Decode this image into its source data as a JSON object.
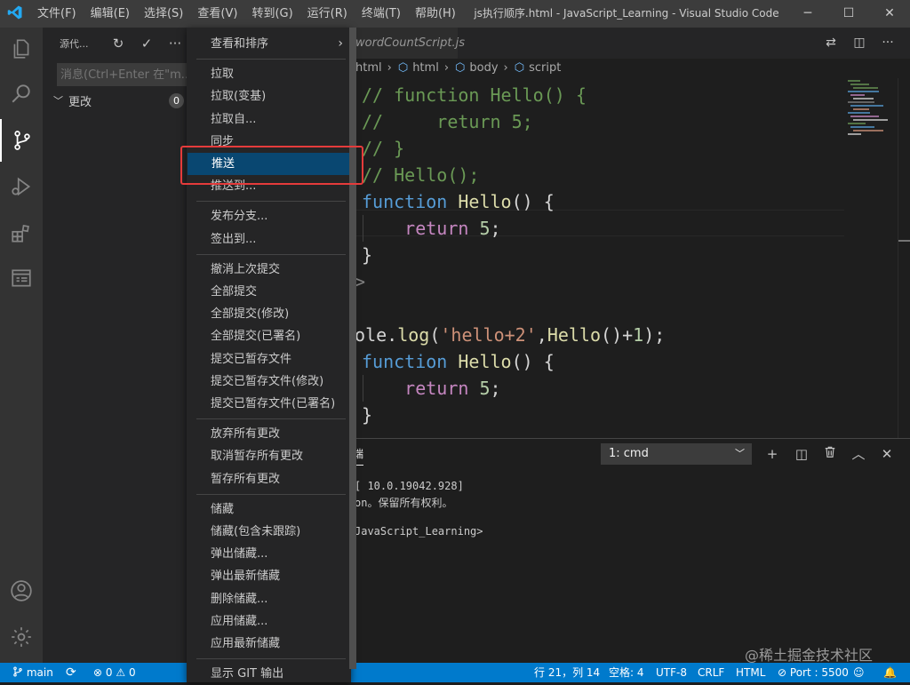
{
  "titlebar": {
    "app_icon": "vscode-logo",
    "menus": [
      "文件(F)",
      "编辑(E)",
      "选择(S)",
      "查看(V)",
      "转到(G)",
      "运行(R)",
      "终端(T)",
      "帮助(H)"
    ],
    "title": "js执行顺序.html - JavaScript_Learning - Visual Studio Code",
    "minimize": "─",
    "maximize": "☐",
    "close": "✕"
  },
  "activitybar": {
    "icons": [
      "explorer-icon",
      "search-icon",
      "source-control-icon",
      "run-debug-icon",
      "extensions-icon",
      "remote-explorer-icon",
      "account-icon",
      "manage-gear-icon"
    ]
  },
  "sidebar": {
    "title": "源代...",
    "refresh": "↻",
    "commit": "✓",
    "more": "···",
    "commit_placeholder": "消息(Ctrl+Enter 在\"m...",
    "changes_label": "更改",
    "changes_count": "0"
  },
  "editor": {
    "tab_label": "wordCountScript.js",
    "breadcrumb": [
      "html",
      "html",
      "body",
      "script"
    ],
    "code_lines": [
      {
        "parts": [
          [
            "cmt",
            "// function Hello() {"
          ]
        ]
      },
      {
        "parts": [
          [
            "cmt",
            "//     return 5;"
          ]
        ]
      },
      {
        "parts": [
          [
            "cmt",
            "// }"
          ]
        ]
      },
      {
        "parts": [
          [
            "cmt",
            "// Hello();"
          ]
        ]
      },
      {
        "parts": [
          [
            "kw",
            "function"
          ],
          [
            "pl",
            " "
          ],
          [
            "fn",
            "Hello"
          ],
          [
            "pl",
            "() {"
          ]
        ]
      },
      {
        "parts": [
          [
            "pl",
            "    "
          ],
          [
            "ctl",
            "return"
          ],
          [
            "pl",
            " "
          ],
          [
            "num",
            "5"
          ],
          [
            "pl",
            ";"
          ]
        ]
      },
      {
        "parts": [
          [
            "pl",
            "}"
          ]
        ]
      },
      {
        "parts": [
          [
            "tag",
            "t>"
          ]
        ]
      },
      {
        "parts": [
          [
            "tag",
            ">"
          ]
        ]
      },
      {
        "parts": [
          [
            "pl",
            "sole."
          ],
          [
            "fn",
            "log"
          ],
          [
            "pl",
            "("
          ],
          [
            "str",
            "'hello+2'"
          ],
          [
            "pl",
            ","
          ],
          [
            "fn",
            "Hello"
          ],
          [
            "pl",
            "()+"
          ],
          [
            "num",
            "1"
          ],
          [
            "pl",
            ");"
          ]
        ]
      },
      {
        "parts": [
          [
            "kw",
            "function"
          ],
          [
            "pl",
            " "
          ],
          [
            "fn",
            "Hello"
          ],
          [
            "pl",
            "() {"
          ]
        ]
      },
      {
        "parts": [
          [
            "pl",
            "    "
          ],
          [
            "ctl",
            "return"
          ],
          [
            "pl",
            " "
          ],
          [
            "num",
            "5"
          ],
          [
            "pl",
            ";"
          ]
        ]
      },
      {
        "parts": [
          [
            "pl",
            "}"
          ]
        ]
      }
    ]
  },
  "panel": {
    "tab_label": "终端",
    "terminal_select": "1: cmd",
    "terminal_lines": [
      "[ 10.0.19042.928]",
      "on。保留所有权利。",
      "",
      "JavaScript_Learning>"
    ],
    "actions": [
      "+",
      "◫",
      "🗑",
      "︿",
      "✕"
    ]
  },
  "context_menu": {
    "items": [
      {
        "label": "查看和排序",
        "submenu": true
      },
      {
        "sep": true
      },
      {
        "label": "拉取"
      },
      {
        "label": "拉取(变基)"
      },
      {
        "label": "拉取自..."
      },
      {
        "label": "同步"
      },
      {
        "label": "推送",
        "active": true
      },
      {
        "label": "推送到..."
      },
      {
        "sep": true
      },
      {
        "label": "发布分支..."
      },
      {
        "label": "签出到..."
      },
      {
        "sep": true
      },
      {
        "label": "撤消上次提交"
      },
      {
        "label": "全部提交"
      },
      {
        "label": "全部提交(修改)"
      },
      {
        "label": "全部提交(已署名)"
      },
      {
        "label": "提交已暂存文件"
      },
      {
        "label": "提交已暂存文件(修改)"
      },
      {
        "label": "提交已暂存文件(已署名)"
      },
      {
        "sep": true
      },
      {
        "label": "放弃所有更改"
      },
      {
        "label": "取消暂存所有更改"
      },
      {
        "label": "暂存所有更改"
      },
      {
        "sep": true
      },
      {
        "label": "储藏"
      },
      {
        "label": "储藏(包含未跟踪)"
      },
      {
        "label": "弹出储藏..."
      },
      {
        "label": "弹出最新储藏"
      },
      {
        "label": "删除储藏..."
      },
      {
        "label": "应用储藏..."
      },
      {
        "label": "应用最新储藏"
      },
      {
        "sep": true
      },
      {
        "label": "显示 GIT 输出"
      }
    ]
  },
  "statusbar": {
    "branch": "main",
    "sync": "⟳",
    "errors": "0",
    "warnings": "0",
    "position": "行 21，列 14",
    "spaces": "空格: 4",
    "encoding": "UTF-8",
    "eol": "CRLF",
    "language": "HTML",
    "port": "Port : 5500"
  },
  "watermark": "@稀土掘金技术社区",
  "colors": {
    "accent": "#007acc",
    "highlight_box": "#e53b3b",
    "menu_active": "#094771"
  }
}
